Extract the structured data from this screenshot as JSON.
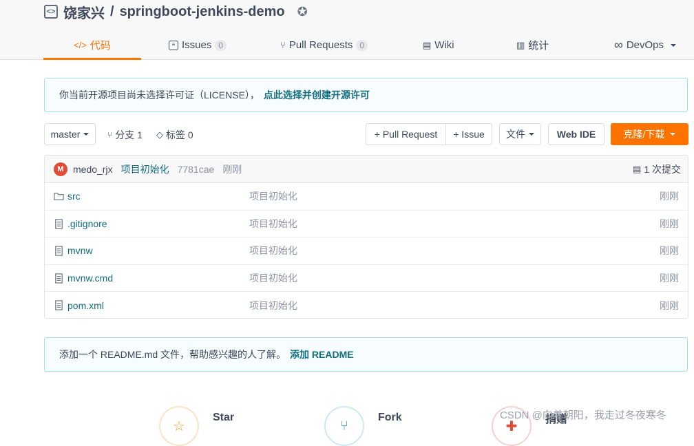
{
  "repo": {
    "owner": "饶家兴",
    "separator": "/",
    "name": "springboot-jenkins-demo",
    "repo_icon": "code-square-icon",
    "badge_icon": "award-icon"
  },
  "tabs": [
    {
      "label": "代码",
      "icon": "code-icon",
      "active": true
    },
    {
      "label": "Issues",
      "count": "0",
      "icon": "issue-icon"
    },
    {
      "label": "Pull Requests",
      "count": "0",
      "icon": "pull-request-icon"
    },
    {
      "label": "Wiki",
      "icon": "book-icon"
    },
    {
      "label": "统计",
      "icon": "bar-chart-icon"
    },
    {
      "label": "DevOps",
      "icon": "infinity-icon"
    }
  ],
  "license_notice": {
    "text": "你当前开源项目尚未选择许可证（LICENSE），",
    "link": "点此选择并创建开源许可"
  },
  "toolbar": {
    "branch": "master",
    "branches": "分支 1",
    "tags": "标签 0",
    "pull_request": "+ Pull Request",
    "issue": "+ Issue",
    "file": "文件",
    "web_ide": "Web IDE",
    "clone": "克隆/下载"
  },
  "commit": {
    "avatar_letter": "M",
    "author": "medo_rjx",
    "message": "项目初始化",
    "sha": "7781cae",
    "time": "刚刚",
    "commits": "1 次提交"
  },
  "files": [
    {
      "name": "src",
      "type": "folder",
      "message": "项目初始化",
      "time": "刚刚"
    },
    {
      "name": ".gitignore",
      "type": "file",
      "message": "项目初始化",
      "time": "刚刚"
    },
    {
      "name": "mvnw",
      "type": "file",
      "message": "项目初始化",
      "time": "刚刚"
    },
    {
      "name": "mvnw.cmd",
      "type": "file",
      "message": "项目初始化",
      "time": "刚刚"
    },
    {
      "name": "pom.xml",
      "type": "file",
      "message": "项目初始化",
      "time": "刚刚"
    }
  ],
  "readme_notice": {
    "text": "添加一个 README.md 文件，帮助感兴趣的人了解。",
    "link": "添加 README"
  },
  "bottom": {
    "star": "Star",
    "fork": "Fork",
    "donate": "捐赠"
  },
  "watermark": "CSDN @向着朝阳，我走过冬夜寒冬",
  "colors": {
    "accent": "#fe7300",
    "link": "#136d81",
    "notice_border": "#a5dde6"
  }
}
